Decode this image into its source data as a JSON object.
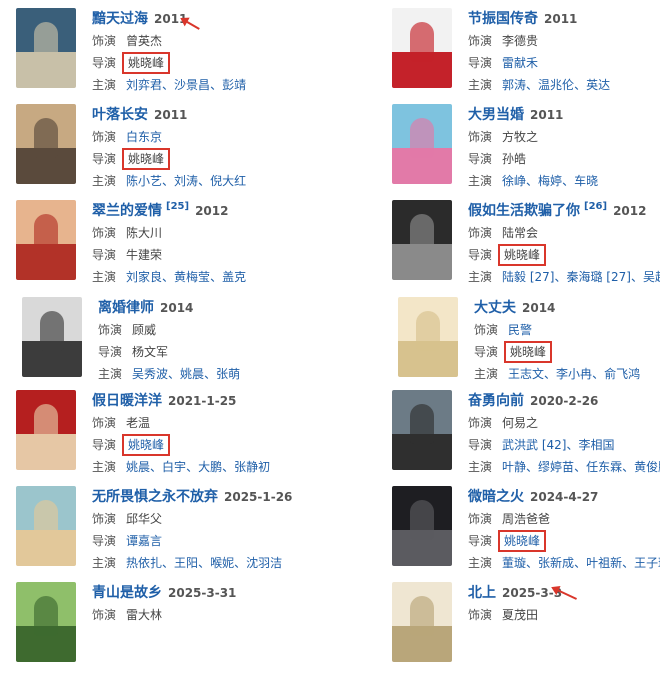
{
  "labels": {
    "cast": "饰演",
    "director": "导演",
    "starring": "主演"
  },
  "entries": [
    {
      "title": "黯天过海",
      "year": "2011",
      "ref": "",
      "cast": "曾英杰",
      "cast_link": false,
      "director": "姚晓峰",
      "director_link": false,
      "starring": [
        "刘弈君",
        "沙景昌",
        "彭靖"
      ],
      "colors": [
        "#3a5f7a",
        "#c8c0a8"
      ]
    },
    {
      "title": "节振国传奇",
      "year": "2011",
      "ref": "",
      "cast": "李德贵",
      "cast_link": false,
      "director": "雷献禾",
      "director_link": true,
      "starring": [
        "郭涛",
        "温兆伦",
        "英达"
      ],
      "colors": [
        "#f2f2f2",
        "#c4222a"
      ]
    },
    {
      "title": "叶落长安",
      "year": "2011",
      "ref": "",
      "cast": "白东京",
      "cast_link": true,
      "director": "姚晓峰",
      "director_link": false,
      "starring": [
        "陈小艺",
        "刘涛",
        "倪大红"
      ],
      "colors": [
        "#c7a982",
        "#5a4a3c"
      ]
    },
    {
      "title": "大男当婚",
      "year": "2011",
      "ref": "",
      "cast": "方牧之",
      "cast_link": false,
      "director": "孙皓",
      "director_link": false,
      "starring": [
        "徐峥",
        "梅婷",
        "车晓"
      ],
      "colors": [
        "#7ec3df",
        "#e27aa8"
      ]
    },
    {
      "title": "翠兰的爱情",
      "year": "2012",
      "ref": "[25]",
      "cast": "陈大川",
      "cast_link": false,
      "director": "牛建荣",
      "director_link": false,
      "starring": [
        "刘家良",
        "黄梅莹",
        "盖克"
      ],
      "colors": [
        "#e7b48e",
        "#b23228"
      ]
    },
    {
      "title": "假如生活欺骗了你",
      "year": "2012",
      "ref": "[26]",
      "cast": "陆常会",
      "cast_link": false,
      "director": "姚晓峰",
      "director_link": false,
      "starring": [
        "陆毅 [27]",
        "秦海璐 [27]",
        "吴越"
      ],
      "colors": [
        "#2b2b2b",
        "#8a8a8a"
      ]
    },
    {
      "title": "离婚律师",
      "year": "2014",
      "ref": "",
      "cast": "顾威",
      "cast_link": false,
      "director": "杨文军",
      "director_link": false,
      "starring": [
        "吴秀波",
        "姚晨",
        "张萌"
      ],
      "colors": [
        "#d9d9d9",
        "#3c3c3c"
      ]
    },
    {
      "title": "大丈夫",
      "year": "2014",
      "ref": "",
      "cast": "民警",
      "cast_link": true,
      "director": "姚晓峰",
      "director_link": false,
      "starring": [
        "王志文",
        "李小冉",
        "俞飞鸿"
      ],
      "colors": [
        "#f3e6c8",
        "#d7c28e"
      ]
    },
    {
      "title": "假日暖洋洋",
      "year": "2021-1-25",
      "ref": "",
      "cast": "老温",
      "cast_link": false,
      "director": "姚晓峰",
      "director_link": true,
      "starring": [
        "姚晨",
        "白宇",
        "大鹏",
        "张静初"
      ],
      "colors": [
        "#b51f1f",
        "#e6c7a5"
      ]
    },
    {
      "title": "奋勇向前",
      "year": "2020-2-26",
      "ref": "",
      "cast": "何易之",
      "cast_link": false,
      "director": "武洪武 [42]",
      "director_link": true,
      "director_extra": "李相国",
      "starring": [
        "叶静",
        "缪婷苗",
        "任东霖",
        "黄俊鹏"
      ],
      "colors": [
        "#6c7b86",
        "#2f2f2f"
      ]
    },
    {
      "title": "无所畏惧之永不放弃",
      "year": "2025-1-26",
      "ref": "",
      "cast": "邱华父",
      "cast_link": false,
      "director": "谭嘉言",
      "director_link": true,
      "starring": [
        "热依扎",
        "王阳",
        "喉妮",
        "沈羽洁"
      ],
      "colors": [
        "#9bc5cc",
        "#e2c89a"
      ]
    },
    {
      "title": "微暗之火",
      "year": "2024-4-27",
      "ref": "",
      "cast": "周浩爸爸",
      "cast_link": false,
      "director": "姚晓峰",
      "director_link": true,
      "starring": [
        "董璇",
        "张新成",
        "叶祖新",
        "王子璇"
      ],
      "colors": [
        "#1e1e22",
        "#5b5b60"
      ]
    },
    {
      "title": "青山是故乡",
      "year": "2025-3-31",
      "ref": "",
      "cast": "雷大林",
      "cast_link": false,
      "director": "",
      "director_link": false,
      "starring": [],
      "colors": [
        "#8fbf6a",
        "#3e6a2f"
      ]
    },
    {
      "title": "北上",
      "year": "2025-3-3",
      "ref": "",
      "cast": "夏茂田",
      "cast_link": false,
      "director": "",
      "director_link": false,
      "starring": [],
      "colors": [
        "#efe6d2",
        "#b9a67a"
      ]
    }
  ]
}
